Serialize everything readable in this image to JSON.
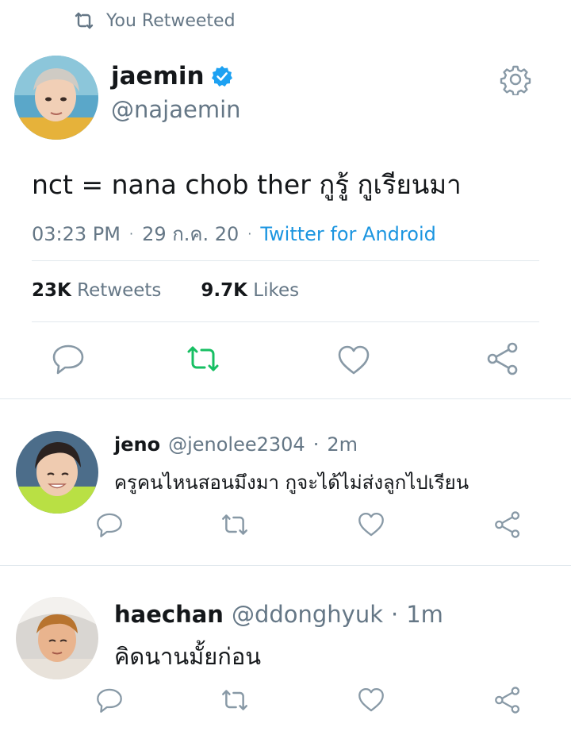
{
  "retweet_banner": {
    "text": "You Retweeted"
  },
  "main_tweet": {
    "name": "jaemin",
    "handle": "@najaemin",
    "verified": true,
    "text": "nct = nana chob ther กูรู้ กูเรียนมา",
    "time": "03:23 PM",
    "date": "29 ก.ค. 20",
    "source": "Twitter for Android",
    "retweets_count": "23K",
    "retweets_label": "Retweets",
    "likes_count": "9.7K",
    "likes_label": "Likes"
  },
  "replies": [
    {
      "name": "jeno",
      "handle": "@jenolee2304",
      "sep": "·",
      "time": "2m",
      "text": "ครูคนไหนสอนมึงมา กูจะได้ไม่ส่งลูกไปเรียน"
    },
    {
      "name": "haechan",
      "handle": "@ddonghyuk",
      "sep": "·",
      "time": "1m",
      "text": "คิดนานมั้ยก่อน"
    }
  ],
  "colors": {
    "accent_blue": "#1b95e0",
    "retweet_green": "#17bf63",
    "icon_gray": "#657786",
    "divider": "#e1e8ed"
  },
  "icons": [
    "retweet-icon",
    "verified-badge-icon",
    "gear-icon",
    "reply-icon",
    "like-icon",
    "share-icon"
  ]
}
